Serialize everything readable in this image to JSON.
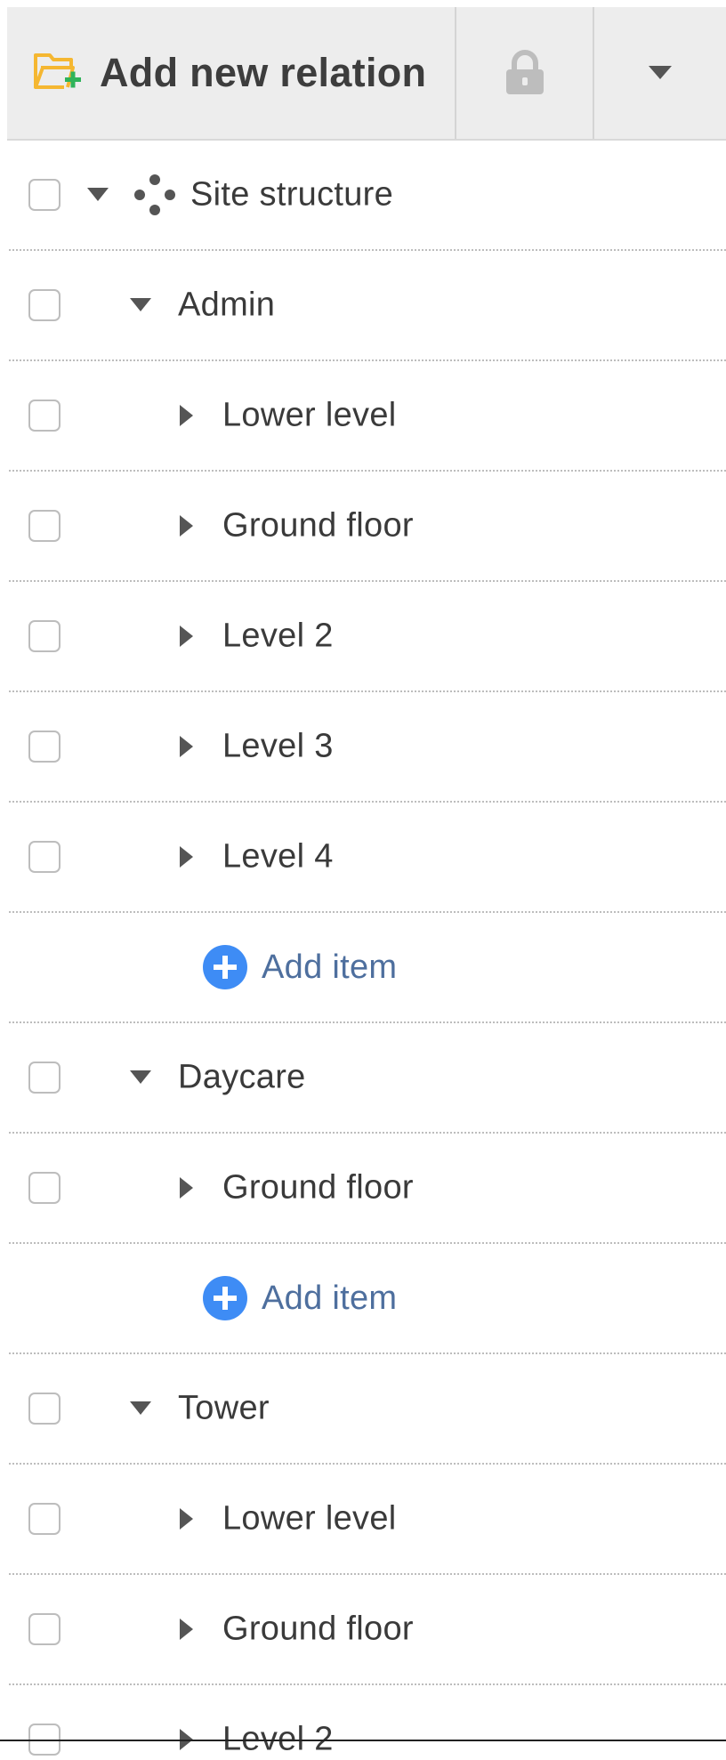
{
  "toolbar": {
    "add_relation_label": "Add new relation",
    "add_relation_icon": "folder-plus-icon",
    "lock_icon": "lock-icon",
    "dropdown_icon": "caret-down-icon"
  },
  "tree": {
    "root": {
      "label": "Site structure",
      "expanded": true,
      "icon": "nodes-icon"
    },
    "groups": [
      {
        "label": "Admin",
        "expanded": true,
        "children": [
          "Lower level",
          "Ground floor",
          "Level 2",
          "Level 3",
          "Level 4"
        ],
        "add_item_label": "Add item"
      },
      {
        "label": "Daycare",
        "expanded": true,
        "children": [
          "Ground floor"
        ],
        "add_item_label": "Add item"
      },
      {
        "label": "Tower",
        "expanded": true,
        "children": [
          "Lower level",
          "Ground floor",
          "Level 2"
        ]
      }
    ]
  },
  "colors": {
    "folder_icon": "#f5b731",
    "plus_badge": "#2fb35a",
    "add_item_circle": "#3e8cf5",
    "add_item_text": "#4e6f9e",
    "toolbar_bg": "#ededed",
    "lock": "#bdbdbd"
  }
}
